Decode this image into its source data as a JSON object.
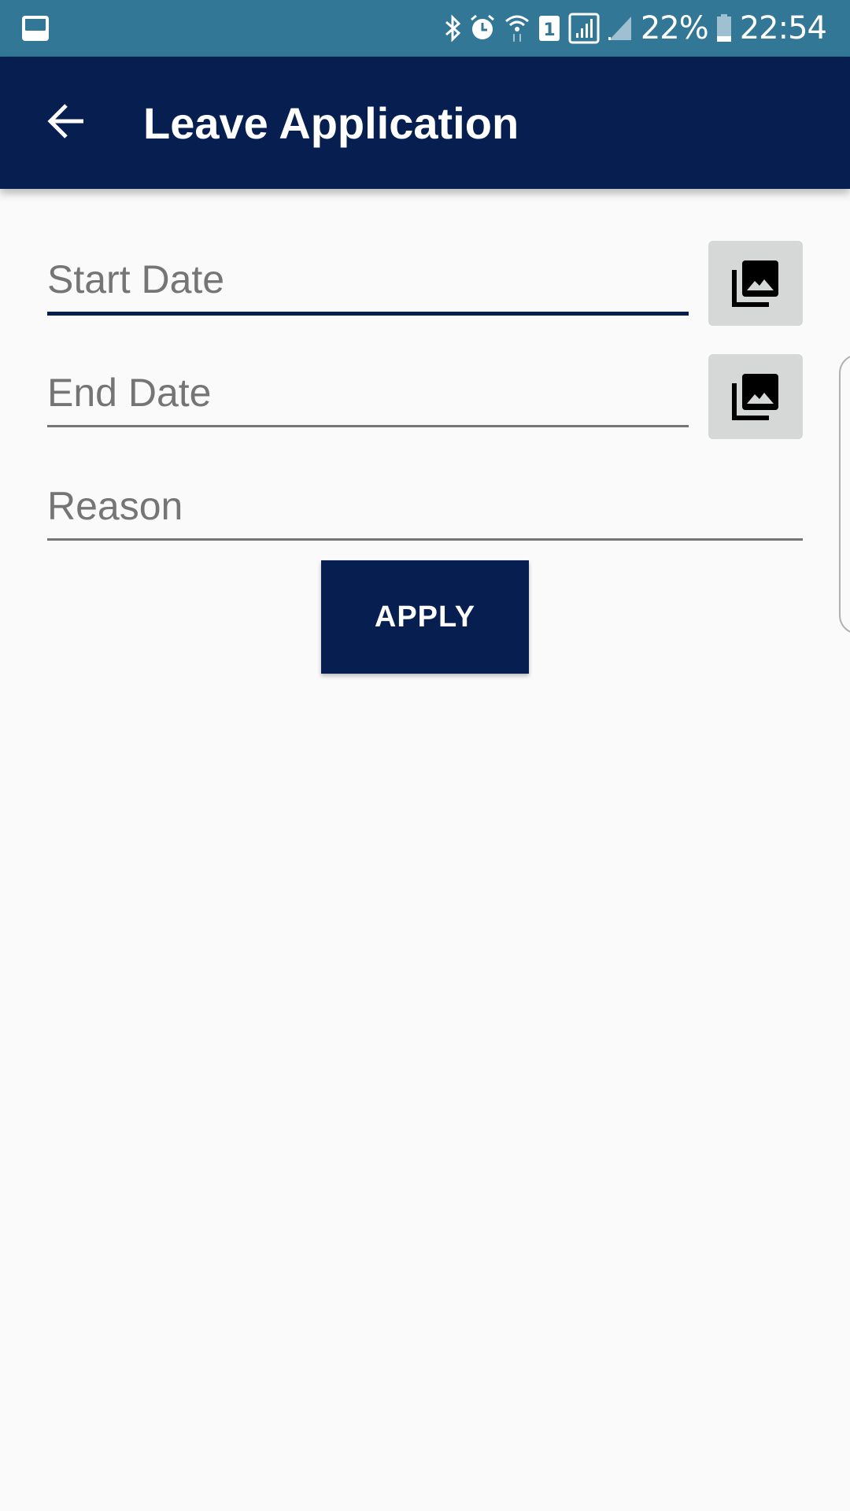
{
  "status_bar": {
    "left_icon": "gallery-notification-icon",
    "icons": [
      "bluetooth-icon",
      "alarm-icon",
      "wifi-icon",
      "sim-1-icon",
      "signal-icon",
      "signal-2-icon",
      "battery-icon"
    ],
    "battery": "22%",
    "time": "22:54"
  },
  "toolbar": {
    "back_icon": "arrow-back-icon",
    "title": "Leave Application"
  },
  "form": {
    "start_date": {
      "placeholder": "Start Date",
      "value": "",
      "picker_icon": "photo-library-icon"
    },
    "end_date": {
      "placeholder": "End Date",
      "value": "",
      "picker_icon": "photo-library-icon"
    },
    "reason": {
      "placeholder": "Reason",
      "value": ""
    },
    "apply_label": "APPLY"
  },
  "colors": {
    "status_bar": "#337797",
    "primary": "#061f50",
    "background": "#fafafa",
    "hint_text": "#757575",
    "icon_button_bg": "#d6d7d7"
  }
}
